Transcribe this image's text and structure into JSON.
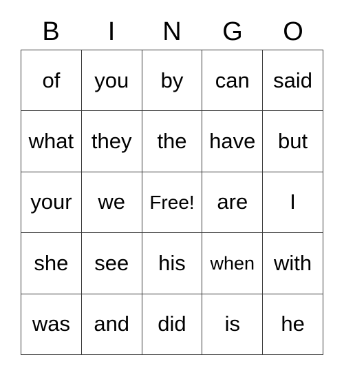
{
  "card": {
    "title": "BINGO",
    "header_letters": [
      "B",
      "I",
      "N",
      "G",
      "O"
    ],
    "free_space_label": "Free!",
    "rows": [
      [
        "of",
        "you",
        "by",
        "can",
        "said"
      ],
      [
        "what",
        "they",
        "the",
        "have",
        "but"
      ],
      [
        "your",
        "we",
        "Free!",
        "are",
        "I"
      ],
      [
        "she",
        "see",
        "his",
        "when",
        "with"
      ],
      [
        "was",
        "and",
        "did",
        "is",
        "he"
      ]
    ],
    "colors": {
      "background": "#ffffff",
      "text": "#000000",
      "grid_line": "#3a3a3a"
    }
  }
}
